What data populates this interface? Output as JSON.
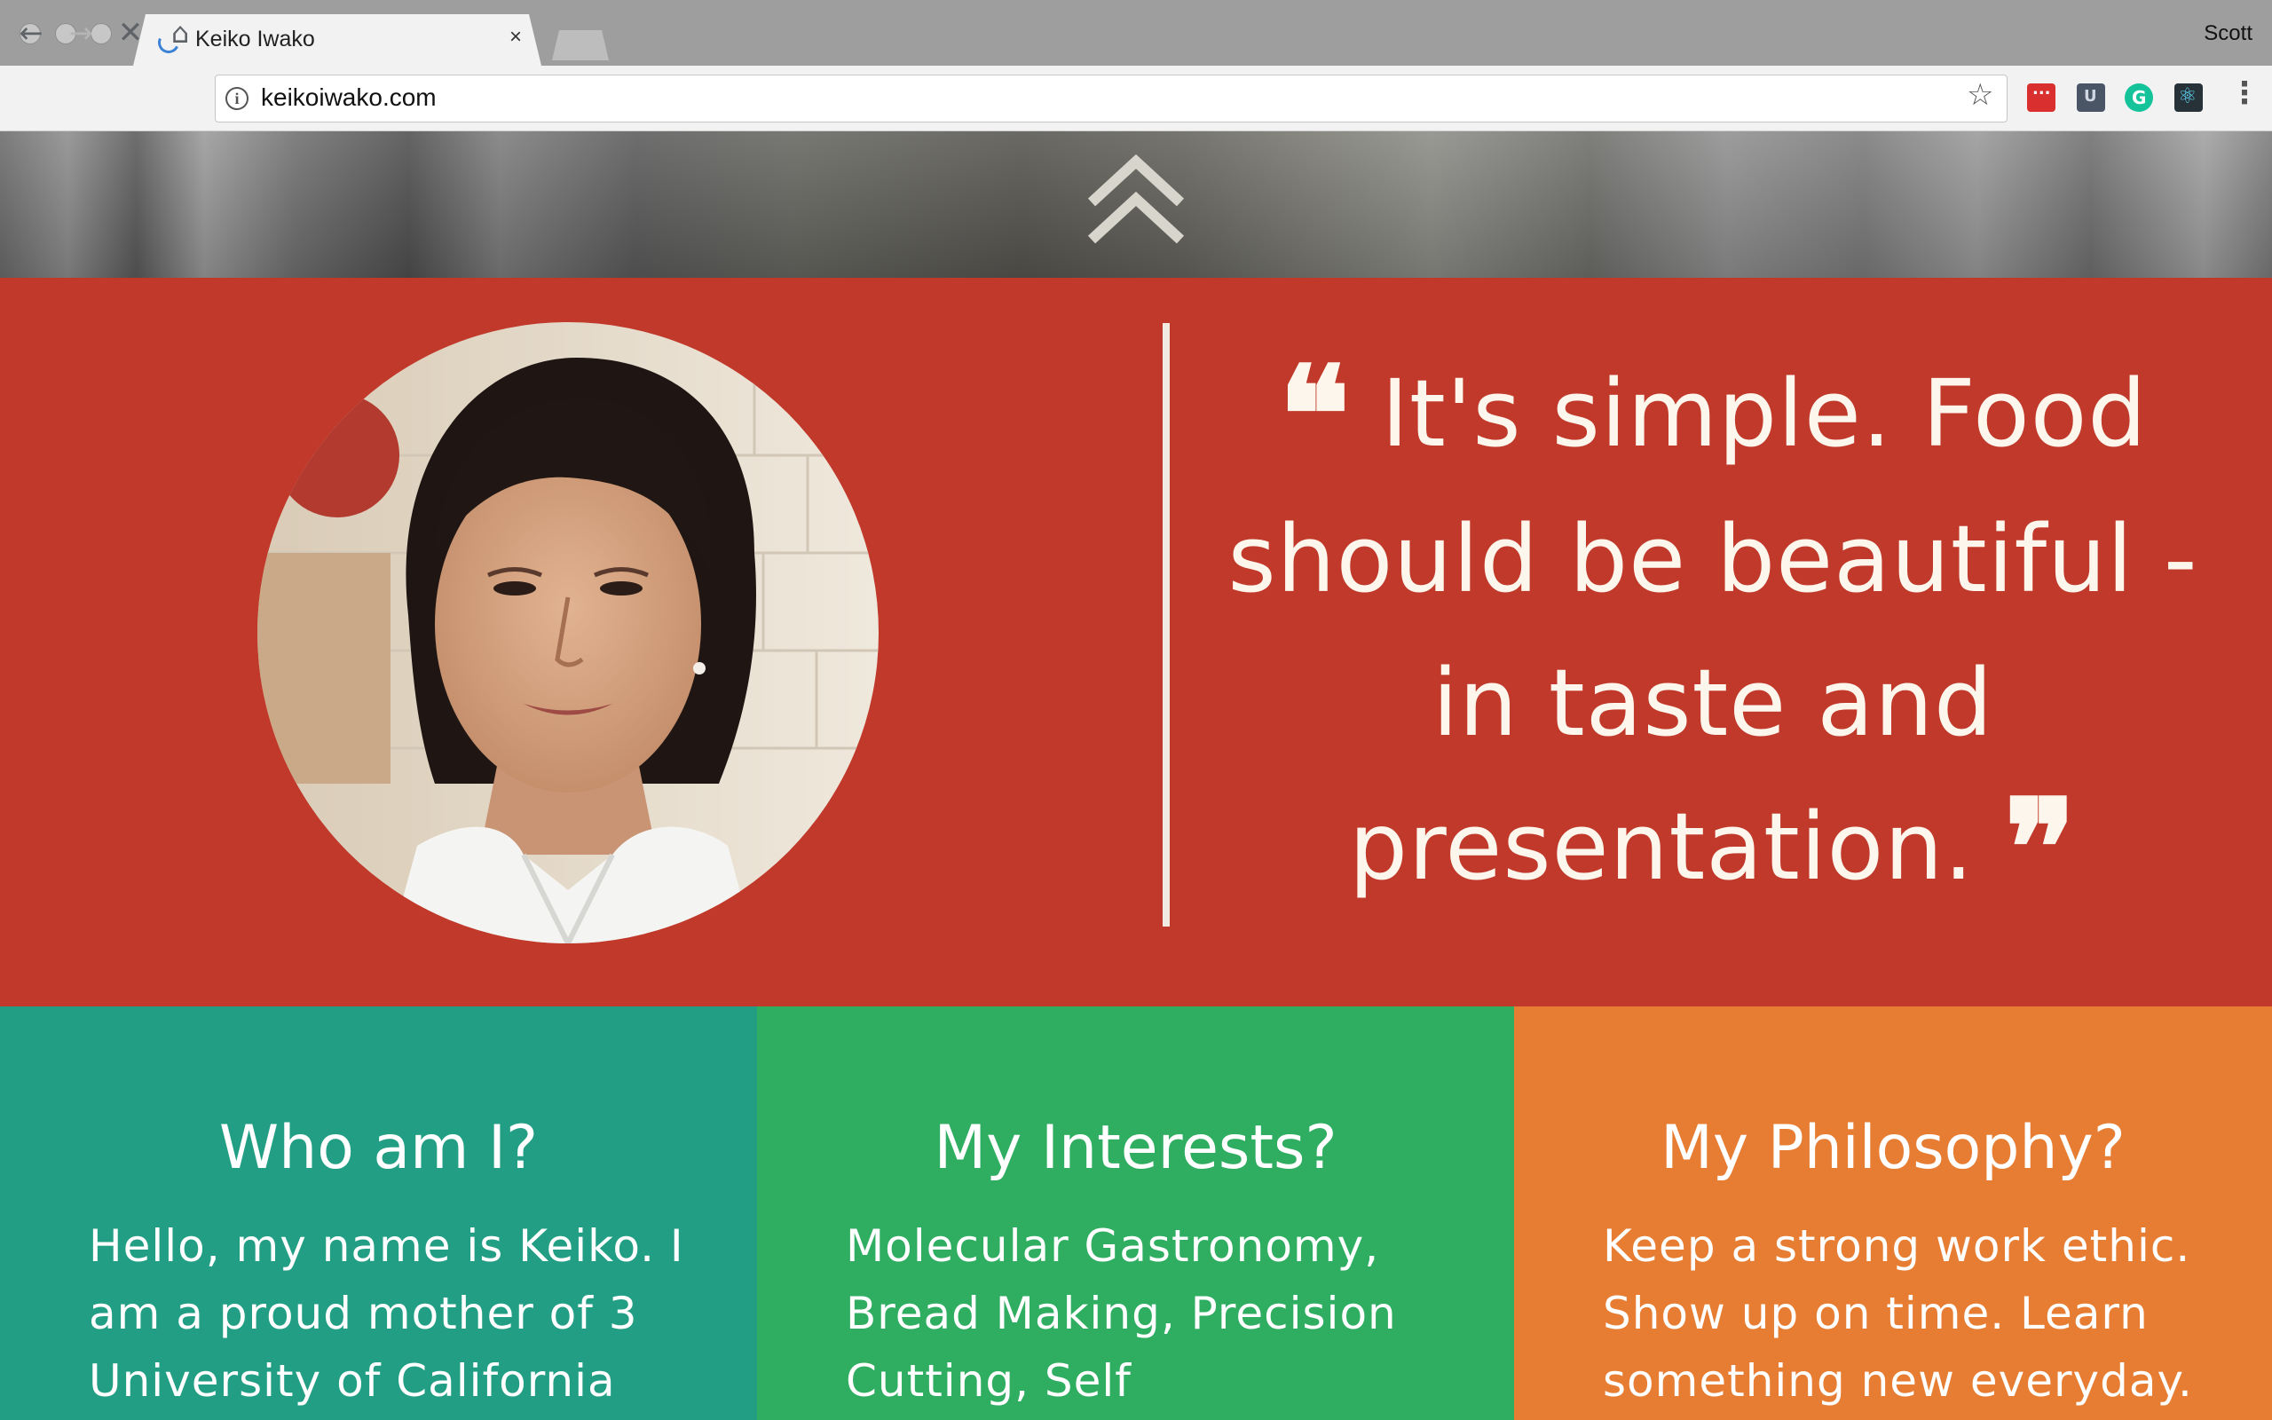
{
  "browser": {
    "tab_title": "Keiko Iwako",
    "tab_close": "×",
    "profile_name": "Scott",
    "url": "keikoiwako.com",
    "info_icon": "i",
    "star_icon": "☆",
    "nav_back": "←",
    "nav_forward": "→",
    "nav_stop": "✕",
    "nav_home": "⌂",
    "menu": "⋮"
  },
  "hero": {
    "scroll_up_icon": "double-chevron-up-icon"
  },
  "quote": {
    "open_mark": "❝",
    "line1": "It's simple. Food",
    "line2": "should be beautiful -",
    "line3": "in taste and",
    "line4": "presentation.",
    "close_mark": "❞"
  },
  "columns": [
    {
      "title": "Who am I?",
      "text": "Hello, my name is Keiko. I am a proud mother of 3 University of California"
    },
    {
      "title": "My Interests?",
      "text": "Molecular Gastronomy, Bread Making, Precision Cutting, Self Improvement,"
    },
    {
      "title": "My Philosophy?",
      "text": "Keep a strong work ethic. Show up on time. Learn something new everyday."
    }
  ],
  "colors": {
    "quote_band": "#c0392b",
    "col1": "#229e85",
    "col2": "#2fad61",
    "col3": "#e67d32"
  }
}
